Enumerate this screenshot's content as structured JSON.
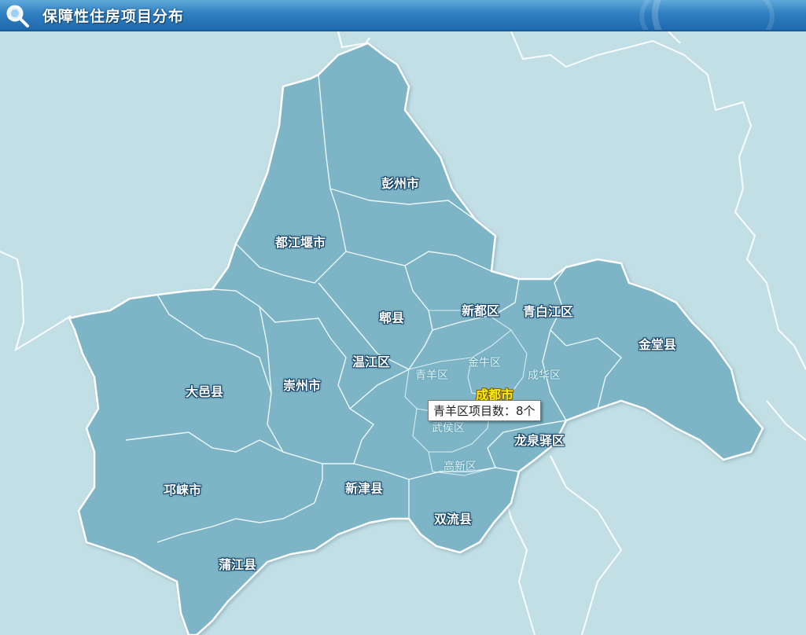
{
  "header": {
    "title": "保障性住房项目分布",
    "icon": "magnifier-icon"
  },
  "colors": {
    "title_bar": "#2f7fc0",
    "region_fill": "#7cb4c5",
    "background": "#c3dfe6",
    "city_label": "#ffee00"
  },
  "map": {
    "regions": [
      {
        "id": "pengzhou",
        "label": "彭州市"
      },
      {
        "id": "dujiangyan",
        "label": "都江堰市"
      },
      {
        "id": "pixian",
        "label": "郫县"
      },
      {
        "id": "xindu",
        "label": "新都区"
      },
      {
        "id": "qingbaijiang",
        "label": "青白江区"
      },
      {
        "id": "jintang",
        "label": "金堂县"
      },
      {
        "id": "wenjiang",
        "label": "温江区"
      },
      {
        "id": "dayi",
        "label": "大邑县"
      },
      {
        "id": "chongzhou",
        "label": "崇州市"
      },
      {
        "id": "qionglai",
        "label": "邛崃市"
      },
      {
        "id": "xinjin",
        "label": "新津县"
      },
      {
        "id": "pujiang",
        "label": "蒲江县"
      },
      {
        "id": "shuangliu",
        "label": "双流县"
      },
      {
        "id": "longquanyi",
        "label": "龙泉驿区"
      }
    ],
    "districts": [
      {
        "id": "qingyang",
        "label": "青羊区"
      },
      {
        "id": "jinniu",
        "label": "金牛区"
      },
      {
        "id": "chenghua",
        "label": "成华区"
      },
      {
        "id": "wuhou",
        "label": "武侯区"
      },
      {
        "id": "gaoxin",
        "label": "高新区"
      }
    ],
    "city": {
      "label": "成都市"
    },
    "tooltip": "青羊区项目数：8个"
  }
}
